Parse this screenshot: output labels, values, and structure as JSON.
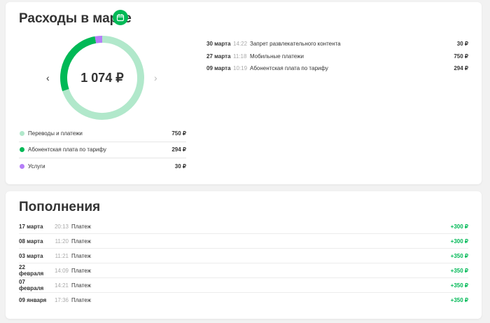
{
  "expenses": {
    "title": "Расходы в марте",
    "calendar_icon": "calendar-icon",
    "total": "1 074 ₽",
    "chart_data": {
      "type": "pie",
      "values": [
        750,
        294,
        30
      ],
      "colors": [
        "#b1e8cb",
        "#00b956",
        "#b57ef8"
      ]
    },
    "legend": [
      {
        "label": "Переводы и платежи",
        "amount": "750 ₽",
        "color": "#b1e8cb"
      },
      {
        "label": "Абонентская плата по тарифу",
        "amount": "294 ₽",
        "color": "#00b956"
      },
      {
        "label": "Услуги",
        "amount": "30 ₽",
        "color": "#b57ef8"
      }
    ],
    "transactions": [
      {
        "date": "30 марта",
        "time": "14:22",
        "desc": "Запрет развлекательного контента",
        "amount": "30 ₽"
      },
      {
        "date": "27 марта",
        "time": "11:18",
        "desc": "Мобильные платежи",
        "amount": "750 ₽"
      },
      {
        "date": "09 марта",
        "time": "10:19",
        "desc": "Абонентская плата по тарифу",
        "amount": "294 ₽"
      }
    ]
  },
  "topups": {
    "title": "Пополнения",
    "rows": [
      {
        "date": "17 марта",
        "time": "20:13",
        "desc": "Платеж",
        "amount": "+300 ₽"
      },
      {
        "date": "08 марта",
        "time": "11:20",
        "desc": "Платеж",
        "amount": "+300 ₽"
      },
      {
        "date": "03 марта",
        "time": "11:21",
        "desc": "Платеж",
        "amount": "+350 ₽"
      },
      {
        "date": "22 февраля",
        "time": "14:09",
        "desc": "Платеж",
        "amount": "+350 ₽"
      },
      {
        "date": "07 февраля",
        "time": "14:21",
        "desc": "Платеж",
        "amount": "+350 ₽"
      },
      {
        "date": "09 января",
        "time": "17:36",
        "desc": "Платеж",
        "amount": "+350 ₽"
      }
    ]
  }
}
